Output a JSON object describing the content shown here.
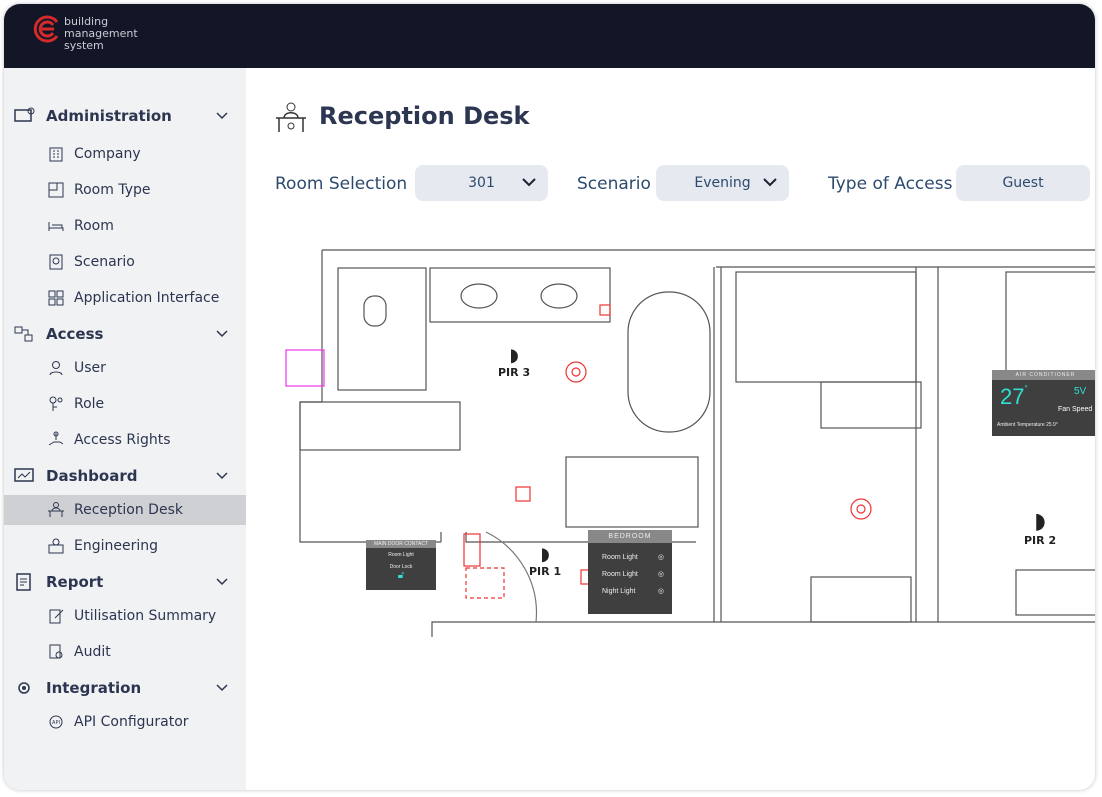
{
  "brand": {
    "line1": "building",
    "line2": "management",
    "line3": "system",
    "accent": "#d42a2a"
  },
  "sidebar": {
    "sections": [
      {
        "label": "Administration",
        "icon": "admin-icon",
        "items": [
          {
            "label": "Company",
            "icon": "building-icon"
          },
          {
            "label": "Room Type",
            "icon": "room-type-icon"
          },
          {
            "label": "Room",
            "icon": "bed-icon"
          },
          {
            "label": "Scenario",
            "icon": "scenario-icon"
          },
          {
            "label": "Application Interface",
            "icon": "grid-icon"
          }
        ]
      },
      {
        "label": "Access",
        "icon": "access-icon",
        "items": [
          {
            "label": "User",
            "icon": "user-icon"
          },
          {
            "label": "Role",
            "icon": "role-icon"
          },
          {
            "label": "Access Rights",
            "icon": "hand-key-icon"
          }
        ]
      },
      {
        "label": "Dashboard",
        "icon": "dashboard-icon",
        "items": [
          {
            "label": "Reception Desk",
            "icon": "reception-icon",
            "active": true
          },
          {
            "label": "Engineering",
            "icon": "engineering-icon"
          }
        ]
      },
      {
        "label": "Report",
        "icon": "report-icon",
        "items": [
          {
            "label": "Utilisation Summary",
            "icon": "edit-doc-icon"
          },
          {
            "label": "Audit",
            "icon": "audit-icon"
          }
        ]
      },
      {
        "label": "Integration",
        "icon": "integration-icon",
        "items": [
          {
            "label": "API Configurator",
            "icon": "api-icon"
          }
        ]
      }
    ]
  },
  "page": {
    "title": "Reception Desk"
  },
  "filters": {
    "room_label": "Room Selection",
    "room_value": "301",
    "scenario_label": "Scenario",
    "scenario_value": "Evening",
    "access_label": "Type of Access",
    "access_value": "Guest"
  },
  "plan": {
    "pir": [
      "PIR 3",
      "PIR 1",
      "PIR 2"
    ],
    "main_door": {
      "title": "MAIN DOOR CONTACT",
      "room_light": "Room Light",
      "door_lock": "Door Lock"
    },
    "bedroom": {
      "title": "BEDROOM",
      "items": [
        "Room Light",
        "Room Light",
        "Night Light"
      ]
    },
    "ac": {
      "title": "AIR CONDITIONER",
      "temp": "27",
      "unit": "°",
      "ambient": "Ambient Temperature 25.9°",
      "setpoint": "5V",
      "fan": "Fan Speed",
      "accent": "#2ee0d0"
    }
  }
}
